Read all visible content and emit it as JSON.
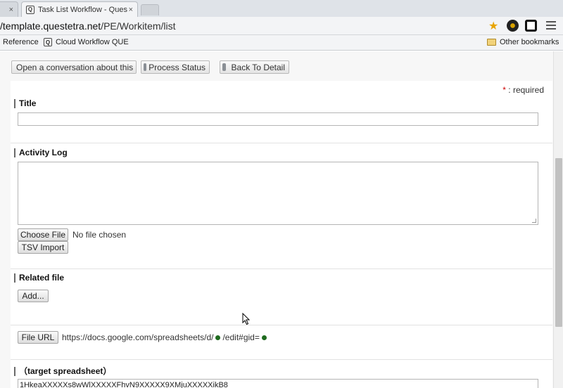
{
  "browser": {
    "prev_tab_close": "×",
    "active_tab": {
      "title": "Task List Workflow - Ques",
      "close": "×",
      "favicon": "Q"
    },
    "url_prefix": "/template.questetra.net",
    "url_path": "/PE/Workitem/list",
    "bookmarks": [
      {
        "label": "Reference"
      },
      {
        "label": "Cloud Workflow QUE"
      }
    ],
    "other_bookmarks": "Other bookmarks"
  },
  "toolbar": {
    "conversation": "Open a conversation about this",
    "process_status": "Process Status",
    "back_to_detail": "Back To Detail"
  },
  "form": {
    "required_star": "*",
    "required_text": ": required",
    "title_label": "Title",
    "title_value": "",
    "activity_log_label": "Activity Log",
    "activity_log_value": "",
    "choose_file": "Choose File",
    "no_file": "No file chosen",
    "tsv_import": "TSV Import",
    "related_file_label": "Related file",
    "add_button": "Add...",
    "file_url_button": "File URL",
    "file_url_prefix": "https://docs.google.com/spreadsheets/d/",
    "file_url_middle": "/edit#gid=",
    "target_label": "（target spreadsheet）",
    "target_value": "1HkeaXXXXXs8wWlXXXXXFhvN9XXXXX9XMjuXXXXXikB8"
  }
}
